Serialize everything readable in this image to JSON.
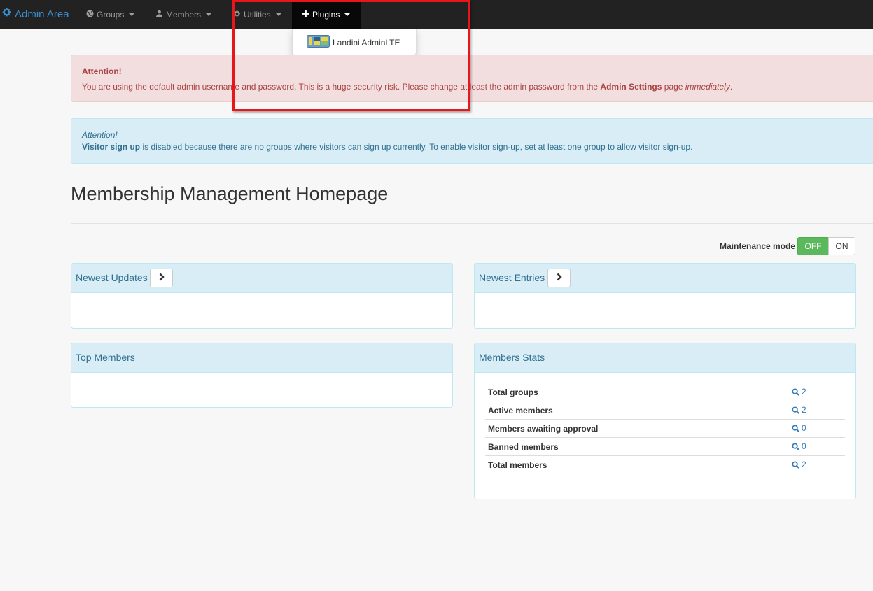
{
  "navbar": {
    "brand": "Admin Area",
    "items": [
      {
        "label": "Groups",
        "icon": "globe-icon"
      },
      {
        "label": "Members",
        "icon": "user-icon"
      },
      {
        "label": "Utilities",
        "icon": "cog-icon"
      },
      {
        "label": "Plugins",
        "icon": "plus-icon"
      }
    ]
  },
  "plugins_menu": {
    "items": [
      {
        "label": "Landini AdminLTE",
        "icon": "adminlte-logo-icon"
      }
    ]
  },
  "alert_danger": {
    "title": "Attention!",
    "text_before": "You are using the default admin username and password. This is a huge security risk. Please change at least the admin password from the ",
    "link": "Admin Settings",
    "text_mid": " page ",
    "emphasis": "immediately",
    "text_end": "."
  },
  "alert_info": {
    "title": "Attention!",
    "bold": "Visitor sign up",
    "text": " is disabled because there are no groups where visitors can sign up currently. To enable visitor sign-up, set at least one group to allow visitor sign-up."
  },
  "page": {
    "title": "Membership Management Homepage"
  },
  "maintenance": {
    "label": "Maintenance mode",
    "off": "OFF",
    "on": "ON",
    "state": "OFF"
  },
  "panels": {
    "newest_updates": "Newest Updates",
    "newest_entries": "Newest Entries",
    "top_members": "Top Members",
    "members_stats": "Members Stats"
  },
  "stats": [
    {
      "label": "Total groups",
      "value": "2"
    },
    {
      "label": "Active members",
      "value": "2"
    },
    {
      "label": "Members awaiting approval",
      "value": "0"
    },
    {
      "label": "Banned members",
      "value": "0"
    },
    {
      "label": "Total members",
      "value": "2"
    }
  ],
  "colors": {
    "navbar": "#222222",
    "brand": "#3b8fcf",
    "danger_bg": "#f2dede",
    "info_bg": "#d9edf7",
    "success": "#5cb85c",
    "highlight": "#e8151b"
  }
}
